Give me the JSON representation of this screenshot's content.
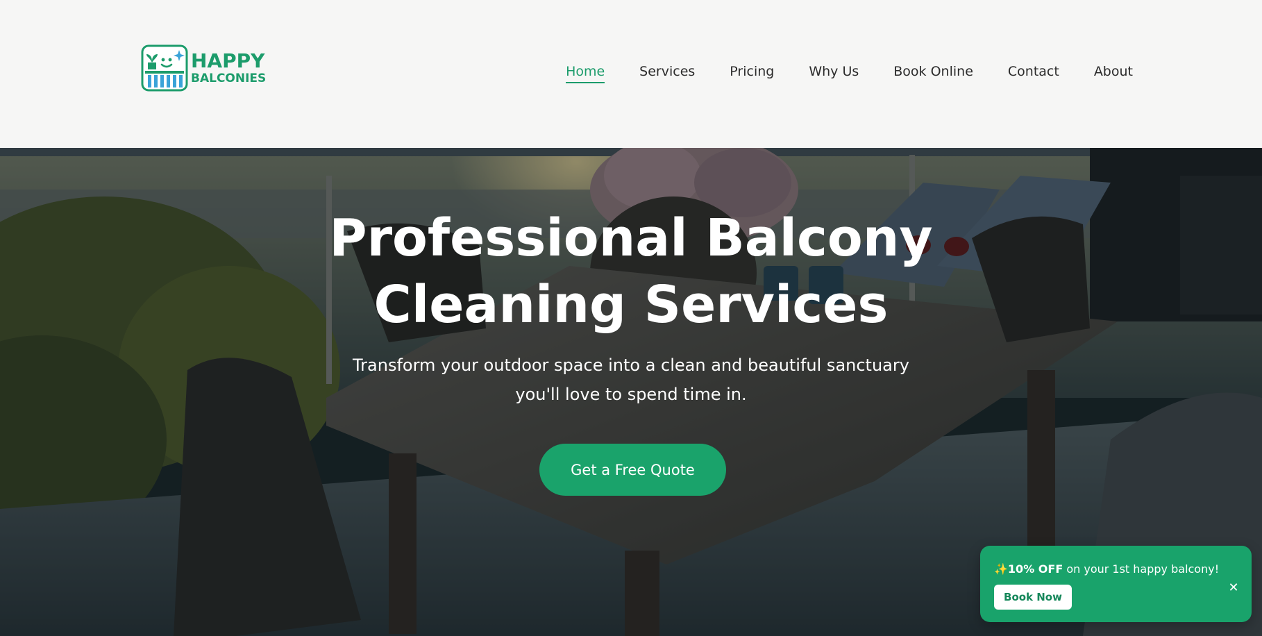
{
  "brand": {
    "name_line1": "HAPPY",
    "name_line2": "BALCONIES",
    "color": "#1c9c6b"
  },
  "nav": {
    "items": [
      {
        "label": "Home",
        "active": true
      },
      {
        "label": "Services",
        "active": false
      },
      {
        "label": "Pricing",
        "active": false
      },
      {
        "label": "Why Us",
        "active": false
      },
      {
        "label": "Book Online",
        "active": false
      },
      {
        "label": "Contact",
        "active": false
      },
      {
        "label": "About",
        "active": false
      }
    ]
  },
  "hero": {
    "title_line1": "Professional Balcony",
    "title_line2": "Cleaning Services",
    "subtitle": "Transform your outdoor space into a clean and beautiful sanctuary you'll love to spend time in.",
    "cta_label": "Get a Free Quote"
  },
  "promo": {
    "emoji": "✨",
    "highlight": "10% OFF",
    "text": " on your 1st happy balcony!",
    "button_label": "Book Now",
    "close_glyph": "✕",
    "color": "#19a36b"
  }
}
